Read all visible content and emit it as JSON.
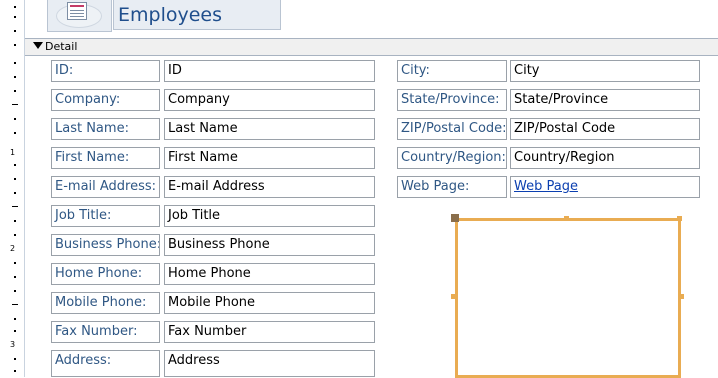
{
  "form": {
    "title": "Employees",
    "section_label": "Detail"
  },
  "ruler": {
    "numbers": [
      "1",
      "2",
      "3"
    ]
  },
  "fields_left": [
    {
      "label": "ID:",
      "control": "ID"
    },
    {
      "label": "Company:",
      "control": "Company"
    },
    {
      "label": "Last Name:",
      "control": "Last Name"
    },
    {
      "label": "First Name:",
      "control": "First Name"
    },
    {
      "label": "E-mail Address:",
      "control": "E-mail Address"
    },
    {
      "label": "Job Title:",
      "control": "Job Title"
    },
    {
      "label": "Business Phone:",
      "control": "Business Phone"
    },
    {
      "label": "Home Phone:",
      "control": "Home Phone"
    },
    {
      "label": "Mobile Phone:",
      "control": "Mobile Phone"
    },
    {
      "label": "Fax Number:",
      "control": "Fax Number"
    },
    {
      "label": "Address:",
      "control": "Address"
    }
  ],
  "fields_right": [
    {
      "label": "City:",
      "control": "City"
    },
    {
      "label": "State/Province:",
      "control": "State/Province"
    },
    {
      "label": "ZIP/Postal Code:",
      "control": "ZIP/Postal Code"
    },
    {
      "label": "Country/Region:",
      "control": "Country/Region"
    },
    {
      "label": "Web Page:",
      "control": "Web Page"
    }
  ],
  "colors": {
    "label_text": "#2f5784",
    "selection": "#e9ac52",
    "title_text": "#1f4e8c"
  },
  "icons": {
    "form_logo": "form-document-icon",
    "section_toggle": "triangle-down-icon"
  }
}
